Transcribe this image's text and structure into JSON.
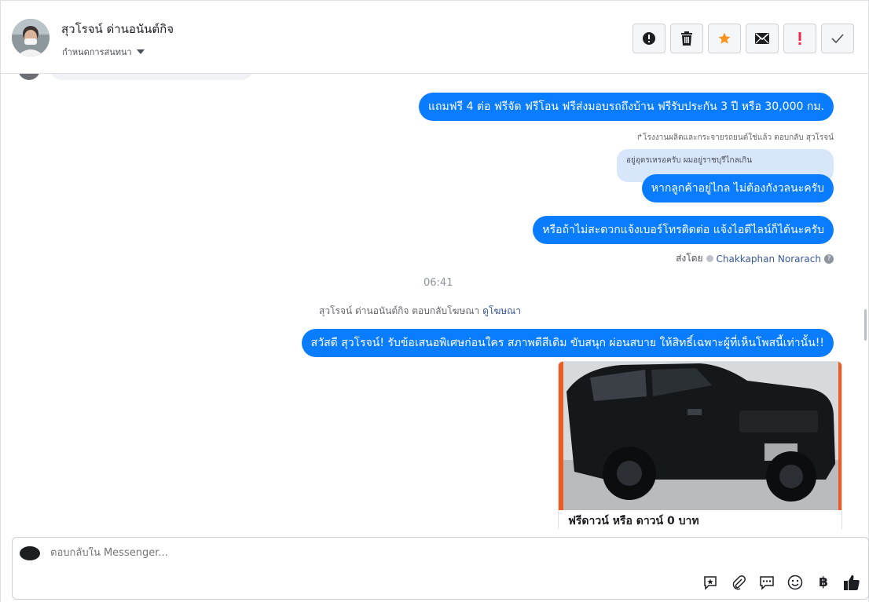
{
  "header": {
    "contact_name": "สุวโรจน์ ด่านอนันต์กิจ",
    "contact_sub": "กำหนดการสนทนา"
  },
  "toolbar": {
    "buttons": [
      {
        "icon": "spam-icon"
      },
      {
        "icon": "trash-icon"
      },
      {
        "icon": "star-icon",
        "color": "#f7931e"
      },
      {
        "icon": "mail-icon"
      },
      {
        "icon": "important-icon",
        "color": "#f02849"
      },
      {
        "icon": "checkmark-icon"
      }
    ]
  },
  "messages": {
    "m1": "แถมฟรี 4 ต่อ ฟรีจัด ฟรีโอน  ฟรีส่งมอบรถถึงบ้าน  ฟรีรับประกัน 3 ปี หรือ 30,000 กม.",
    "reply_note": "↱โรงงานผลิตและกระจายรถยนต์ใช่แล้ว ตอบกลับ สุวโรจน์",
    "quoted": "อยู่อุดรเหรอครับ ผมอยู่ราชบุรีไกลเกิน",
    "m2": "หากลูกค้าอยู่ไกล ไม่ต้องกังวลนะครับ",
    "m3": "หรือถ้าไม่สะดวกแจ้งเบอร์โทรติดต่อ แจ้งไอดีไลน์ก็ได้นะครับ",
    "sent_by_label": "ส่งโดย",
    "sent_by_agent": "Chakkaphan Norarach",
    "help_glyph": "?",
    "timestamp": "06:41",
    "ad_reply_text": "สุวโรจน์ ด่านอนันต์กิจ ตอบกลับโฆษณา",
    "ad_reply_link": "ดูโฆษณา",
    "m4": "สวัสดี สุวโรจน์! รับข้อเสนอพิเศษก่อนใคร สภาพดีสีเดิม ขับสนุก ผ่อนสบาย ให้สิทธิ์เฉพาะผู้ที่เห็นโพสนี้เท่านั้น!!",
    "card_title": "ฟรีดาวน์ หรือ ดาวน์ 0 บาท"
  },
  "composer": {
    "placeholder": "ตอบกลับใน Messenger...",
    "currency_glyph": "฿"
  },
  "colors": {
    "accent": "#0a7cff",
    "card_background": "#ef5a1f"
  }
}
